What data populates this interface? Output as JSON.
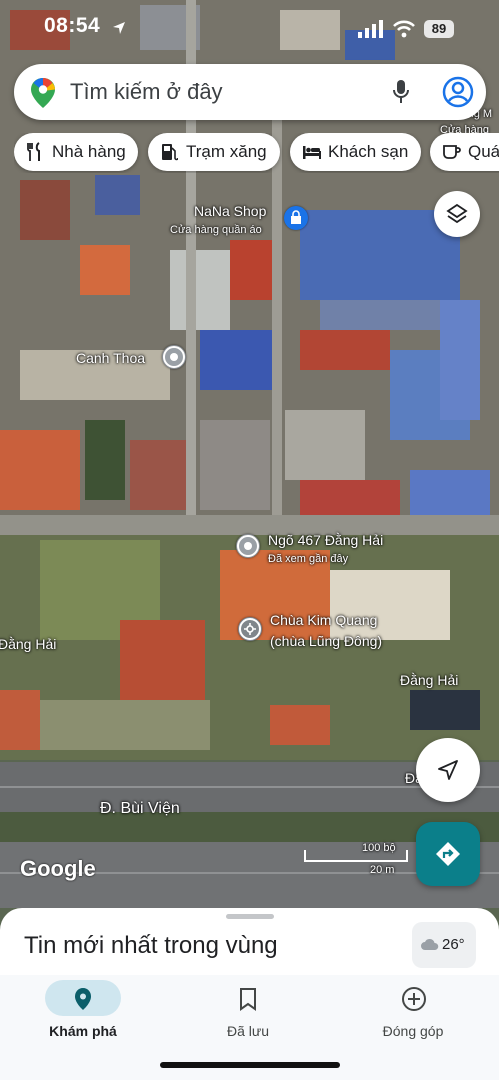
{
  "status_bar": {
    "time": "08:54",
    "battery": "89"
  },
  "search": {
    "placeholder": "Tìm kiếm ở đây"
  },
  "chips": [
    {
      "label": "Nhà hàng",
      "icon": "fork-knife-icon"
    },
    {
      "label": "Trạm xăng",
      "icon": "gas-pump-icon"
    },
    {
      "label": "Khách sạn",
      "icon": "bed-icon"
    },
    {
      "label": "Quá",
      "icon": "coffee-cup-icon"
    }
  ],
  "map": {
    "places": [
      {
        "name": "NaNa Shop",
        "subtitle": "Cửa hàng quần áo"
      },
      {
        "name": "Canh Thoa"
      },
      {
        "name": "Ngõ 467 Đằng Hải",
        "subtitle": "Đã xem gần đây"
      },
      {
        "name": "Chùa Kim Quang",
        "subtitle": "(chùa Lũng Đông)"
      }
    ],
    "roads": [
      "Đằng Hải",
      "Đằng Hải",
      "Đ. Bùi Viện",
      "Đằng",
      "Khang M",
      "Cửa hàng"
    ],
    "scale": {
      "feet": "100 bộ",
      "meters": "20 m"
    },
    "attribution": "Google"
  },
  "sheet": {
    "title": "Tin mới nhất trong vùng",
    "temperature": "26°"
  },
  "nav": [
    {
      "label": "Khám phá",
      "icon": "location-pin-icon",
      "active": true
    },
    {
      "label": "Đã lưu",
      "icon": "bookmark-icon",
      "active": false
    },
    {
      "label": "Đóng góp",
      "icon": "add-circle-icon",
      "active": false
    }
  ],
  "colors": {
    "accent": "#1a73e8",
    "directions": "#0b7f8a",
    "nav_active": "#cfe6ef"
  }
}
